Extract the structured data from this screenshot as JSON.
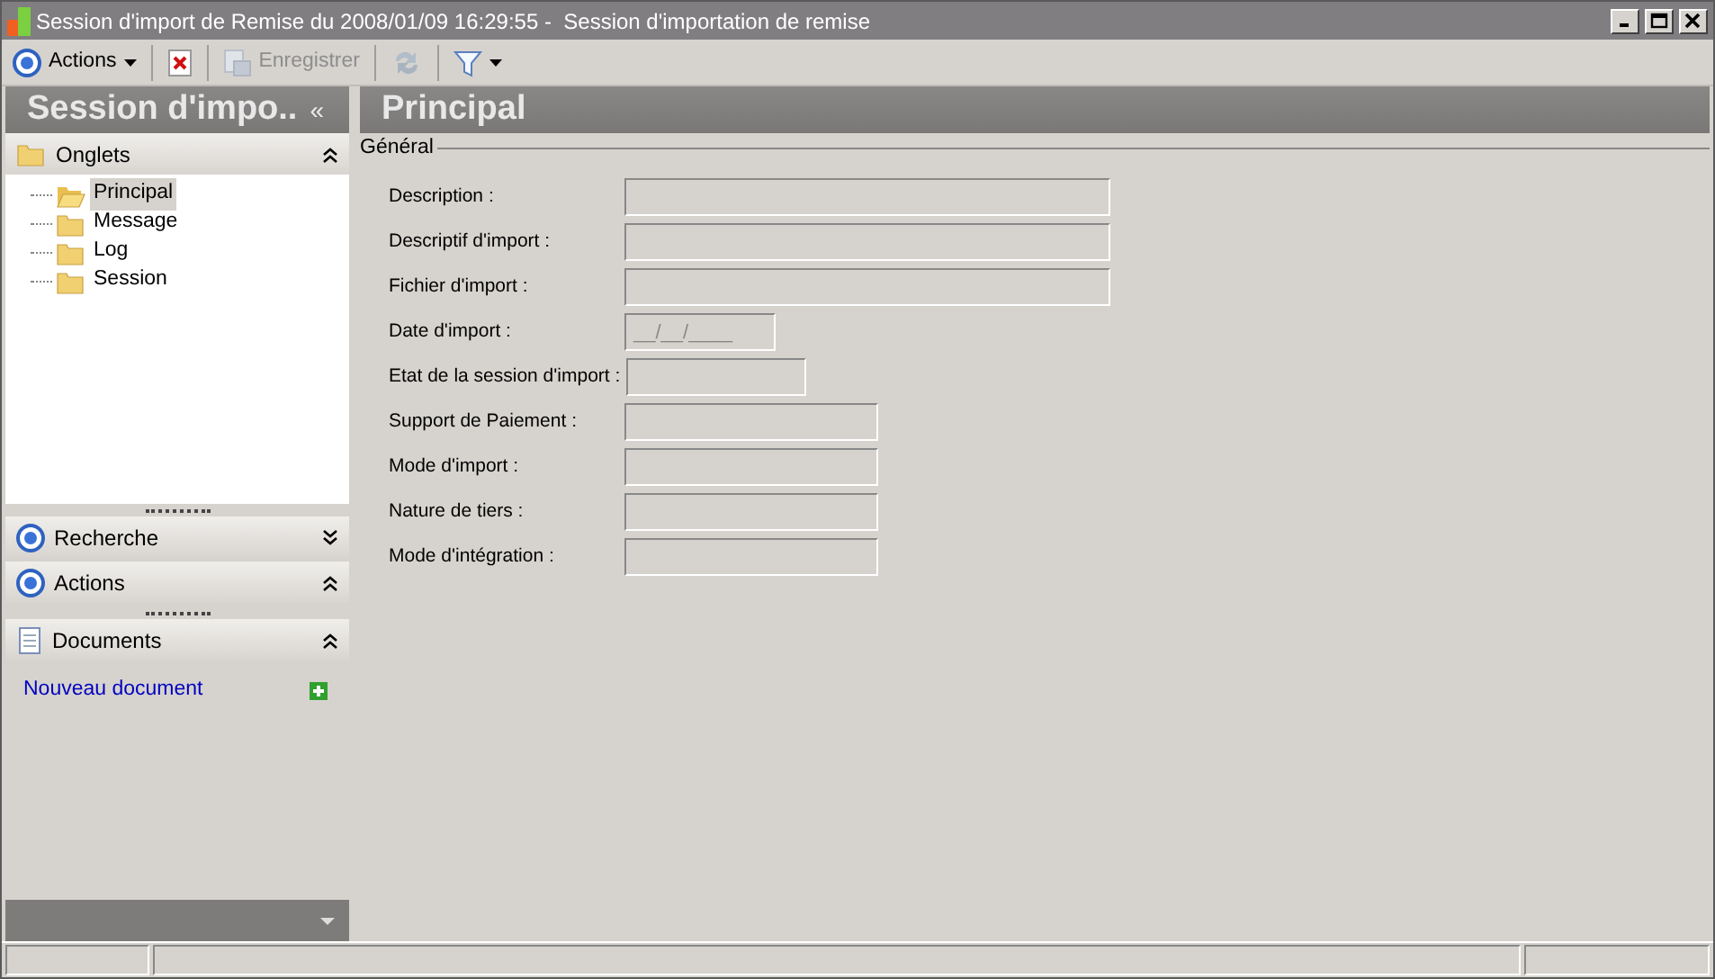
{
  "window": {
    "title": "Session d'import de Remise du 2008/01/09 16:29:55 -  Session d'importation de remise"
  },
  "toolbar": [
    {
      "kind": "circle",
      "label": "Actions",
      "disabled": false,
      "dropdown": true
    },
    {
      "kind": "delete",
      "disabled": false,
      "dropdown": false
    },
    {
      "kind": "save",
      "label": "Enregistrer",
      "disabled": true,
      "dropdown": false
    },
    {
      "kind": "refresh",
      "disabled": true,
      "dropdown": false
    },
    {
      "kind": "filter",
      "disabled": false,
      "dropdown": true
    }
  ],
  "sidebar": {
    "title": "Session d'impo..",
    "collapse": "«",
    "tabs_panel": {
      "title": "Onglets",
      "expanded": true,
      "items": [
        {
          "label": "Principal",
          "selected": true
        },
        {
          "label": "Message",
          "selected": false
        },
        {
          "label": "Log",
          "selected": false
        },
        {
          "label": "Session",
          "selected": false
        }
      ]
    },
    "panels": [
      {
        "kind": "circle",
        "title": "Recherche",
        "expanded": false
      },
      {
        "kind": "circle",
        "title": "Actions",
        "expanded": true
      },
      {
        "kind": "doc",
        "title": "Documents",
        "expanded": true
      }
    ],
    "documents": [
      {
        "label": "Nouveau document"
      }
    ]
  },
  "main": {
    "title": "Principal",
    "group": "Général",
    "fields": [
      {
        "label": "Description :",
        "kind": "wide"
      },
      {
        "label": "Descriptif d'import :",
        "kind": "wide"
      },
      {
        "label": "Fichier d'import :",
        "kind": "wide"
      },
      {
        "label": "Date d'import :",
        "kind": "date",
        "value": "__/__/____"
      },
      {
        "label": "Etat de la session d'import :",
        "kind": "short"
      },
      {
        "label": "Support de Paiement :",
        "kind": "medium"
      },
      {
        "label": "Mode d'import :",
        "kind": "medium"
      },
      {
        "label": "Nature de tiers :",
        "kind": "medium"
      },
      {
        "label": "Mode d'intégration :",
        "kind": "medium"
      }
    ]
  }
}
